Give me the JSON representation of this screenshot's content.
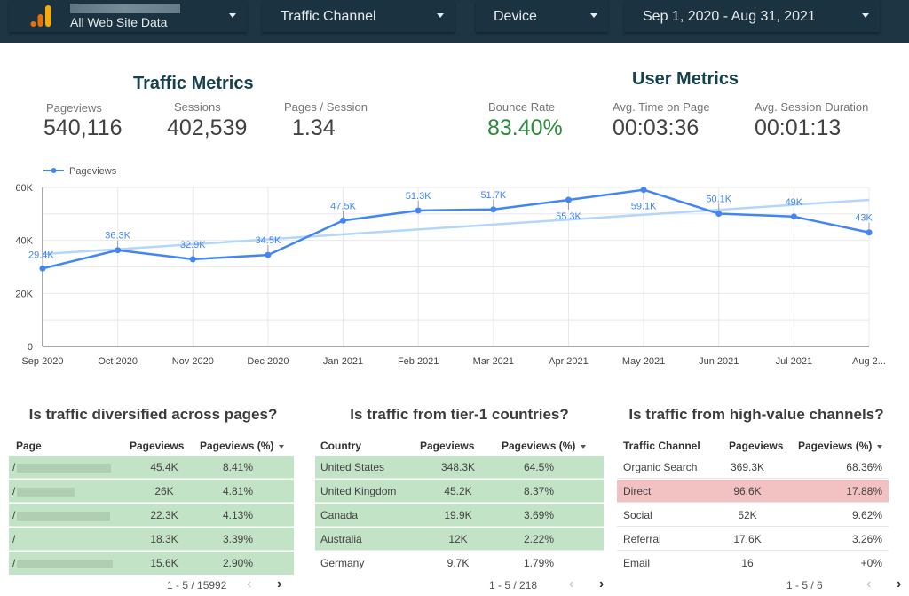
{
  "controls": {
    "data_source": {
      "label": "All Web Site Data",
      "account_redacted": true
    },
    "traffic_channel": {
      "label": "Traffic Channel"
    },
    "device": {
      "label": "Device"
    },
    "date_range": {
      "label": "Sep 1, 2020 - Aug 31, 2021"
    }
  },
  "colors": {
    "header_bg": "#1e3644",
    "title": "#16414e",
    "series": "#4285f4",
    "trend": "#b3d6fb",
    "highlight_green": "#c3e3c6",
    "highlight_red": "#f2c1c1",
    "bounce_green": "#2e8b3e",
    "logo_orange": "#f4a028"
  },
  "traffic_metrics": {
    "title": "Traffic Metrics",
    "items": [
      {
        "label": "Pageviews",
        "value": "540,116"
      },
      {
        "label": "Sessions",
        "value": "402,539"
      },
      {
        "label": "Pages / Session",
        "value": "1.34"
      }
    ]
  },
  "user_metrics": {
    "title": "User Metrics",
    "items": [
      {
        "label": "Bounce Rate",
        "value": "83.40%"
      },
      {
        "label": "Avg. Time on Page",
        "value": "00:03:36"
      },
      {
        "label": "Avg. Session Duration",
        "value": "00:01:13"
      }
    ]
  },
  "chart_data": {
    "type": "line",
    "title": "",
    "xlabel": "",
    "ylabel": "",
    "legend": {
      "entries": [
        "Pageviews"
      ],
      "placement": "top-left"
    },
    "categories": [
      "Sep 2020",
      "Oct 2020",
      "Nov 2020",
      "Dec 2020",
      "Jan 2021",
      "Feb 2021",
      "Mar 2021",
      "Apr 2021",
      "May 2021",
      "Jun 2021",
      "Jul 2021",
      "Aug 2..."
    ],
    "series": [
      {
        "name": "Pageviews",
        "values": [
          29400,
          36300,
          32900,
          34500,
          47500,
          51300,
          51700,
          55300,
          59100,
          50100,
          49000,
          43000
        ],
        "labels": [
          "29.4K",
          "36.3K",
          "32.9K",
          "34.5K",
          "47.5K",
          "51.3K",
          "51.7K",
          "55.3K",
          "59.1K",
          "50.1K",
          "49K",
          "43K"
        ]
      }
    ],
    "trendline": {
      "start": 34800,
      "end": 55300
    },
    "ylim": [
      0,
      60000
    ],
    "yticks": [
      0,
      20000,
      40000,
      60000
    ],
    "ytick_labels": [
      "0",
      "20K",
      "40K",
      "60K"
    ],
    "grid": true
  },
  "tables": [
    {
      "title": "Is traffic diversified across pages?",
      "columns": [
        "Page",
        "Pageviews",
        "Pageviews (%)"
      ],
      "rows": [
        {
          "dim": "/",
          "redacted": true,
          "pv": "45.4K",
          "pct": "8.41%",
          "hl": "green"
        },
        {
          "dim": "/",
          "redacted": true,
          "pv": "26K",
          "pct": "4.81%",
          "hl": "green"
        },
        {
          "dim": "/",
          "redacted": true,
          "pv": "22.3K",
          "pct": "4.13%",
          "hl": "green"
        },
        {
          "dim": "/",
          "redacted": false,
          "pv": "18.3K",
          "pct": "3.39%",
          "hl": "green"
        },
        {
          "dim": "/",
          "redacted": true,
          "pv": "15.6K",
          "pct": "2.90%",
          "hl": "green"
        }
      ],
      "pagination": "1 - 5 / 15992"
    },
    {
      "title": "Is traffic from tier-1 countries?",
      "columns": [
        "Country",
        "Pageviews",
        "Pageviews (%)"
      ],
      "rows": [
        {
          "dim": "United States",
          "pv": "348.3K",
          "pct": "64.5%",
          "hl": "green"
        },
        {
          "dim": "United Kingdom",
          "pv": "45.2K",
          "pct": "8.37%",
          "hl": "green"
        },
        {
          "dim": "Canada",
          "pv": "19.9K",
          "pct": "3.69%",
          "hl": "green"
        },
        {
          "dim": "Australia",
          "pv": "12K",
          "pct": "2.22%",
          "hl": "green"
        },
        {
          "dim": "Germany",
          "pv": "9.7K",
          "pct": "1.79%",
          "hl": "none"
        }
      ],
      "pagination": "1 - 5 / 218"
    },
    {
      "title": "Is traffic from high-value channels?",
      "columns": [
        "Traffic Channel",
        "Pageviews",
        "Pageviews (%)"
      ],
      "rows": [
        {
          "dim": "Organic Search",
          "pv": "369.3K",
          "pct": "68.36%",
          "hl": "none"
        },
        {
          "dim": "Direct",
          "pv": "96.6K",
          "pct": "17.88%",
          "hl": "red"
        },
        {
          "dim": "Social",
          "pv": "52K",
          "pct": "9.62%",
          "hl": "none"
        },
        {
          "dim": "Referral",
          "pv": "17.6K",
          "pct": "3.26%",
          "hl": "none"
        },
        {
          "dim": "Email",
          "pv": "16",
          "pct": "+0%",
          "hl": "none"
        }
      ],
      "pagination": "1 - 5 / 6"
    }
  ],
  "pager_icons": {
    "prev": "‹",
    "next": "›"
  }
}
